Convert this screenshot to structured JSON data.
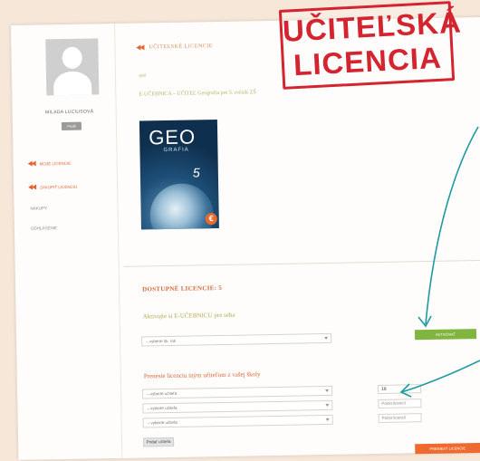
{
  "stamp": {
    "line1": "UČITEĽSKÁ",
    "line2": "LICENCIA",
    "color": "#d3242f"
  },
  "sidebar": {
    "user_name": "MILADA LUCIUSOVÁ",
    "user_button": "Profil",
    "items": [
      {
        "label": "MOJE LICENCIE",
        "icon": "double-arrow-left-icon"
      },
      {
        "label": "ZAKÚPIŤ LICENCIU",
        "icon": "double-arrow-left-icon"
      },
      {
        "label": "NÁKUPY"
      },
      {
        "label": "ODHLÁSENIE"
      }
    ]
  },
  "main": {
    "breadcrumb": "UČITEĽSKÉ LICENCIE",
    "small_link": "späť",
    "book_title": "E-UČEBNICA – UČITEĽ Geografia pre 5. ročník ZŠ",
    "book_cover": {
      "title": "GEO",
      "subtitle": "GRAFIA",
      "number": "5",
      "badge": "€"
    },
    "licenses_heading": "DOSTUPNÉ LICENCIE: 5",
    "assign_heading": "Aktivujte si E-UČEBNICU pre seba",
    "assign_select": "– vyberte šk. rok",
    "assign_button": "AKTIVOVAŤ",
    "transfer_heading": "Preneste licenciu iným učiteľom z vašej školy",
    "transfer_rows": [
      {
        "select": "– vyberte učiteľa",
        "input": "18"
      },
      {
        "select": "– vyberte učiteľa",
        "input": "Počet licencií"
      },
      {
        "select": "– vyberte učiteľa",
        "input": "Počet licencií"
      }
    ],
    "add_teacher_button": "Pridať učiteľa",
    "transfer_button": "PRENIESŤ LICENCIE"
  },
  "colors": {
    "accent_orange": "#e0663a",
    "accent_olive": "#b8b26a",
    "green_button": "#80b640",
    "annotation_teal": "#1f9aa0"
  }
}
